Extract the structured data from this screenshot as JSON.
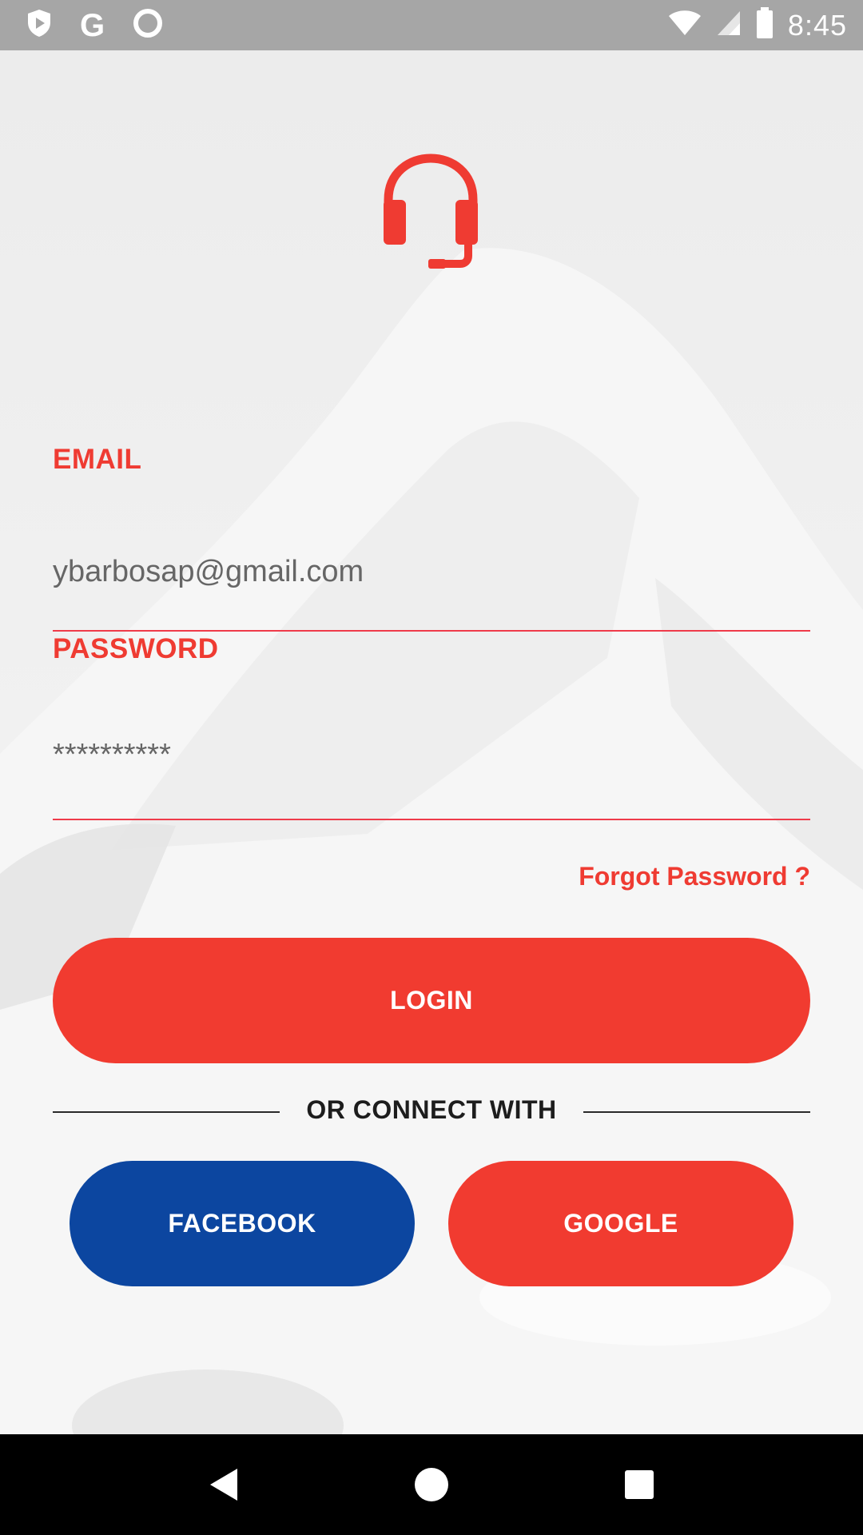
{
  "status_bar": {
    "app_icons": [
      "shield-play-icon",
      "google-g-icon",
      "circle-icon"
    ],
    "google_letter": "G",
    "system_icons": [
      "wifi-icon",
      "cell-signal-icon",
      "battery-icon"
    ],
    "time": "8:45"
  },
  "login": {
    "logo_icon": "headset-icon",
    "email_label": "EMAIL",
    "email_value": "ybarbosap@gmail.com",
    "password_label": "PASSWORD",
    "password_value": "**********",
    "forgot_label": "Forgot Password ?",
    "login_button": "LOGIN",
    "divider_text": "OR CONNECT WITH",
    "facebook_button": "FACEBOOK",
    "google_button": "GOOGLE"
  },
  "colors": {
    "accent": "#f13b30",
    "facebook": "#0c46a0",
    "status_bar": "#a6a6a6",
    "nav_bar": "#000000"
  },
  "nav_bar": {
    "icons": [
      "back-icon",
      "home-icon",
      "recents-icon"
    ]
  }
}
